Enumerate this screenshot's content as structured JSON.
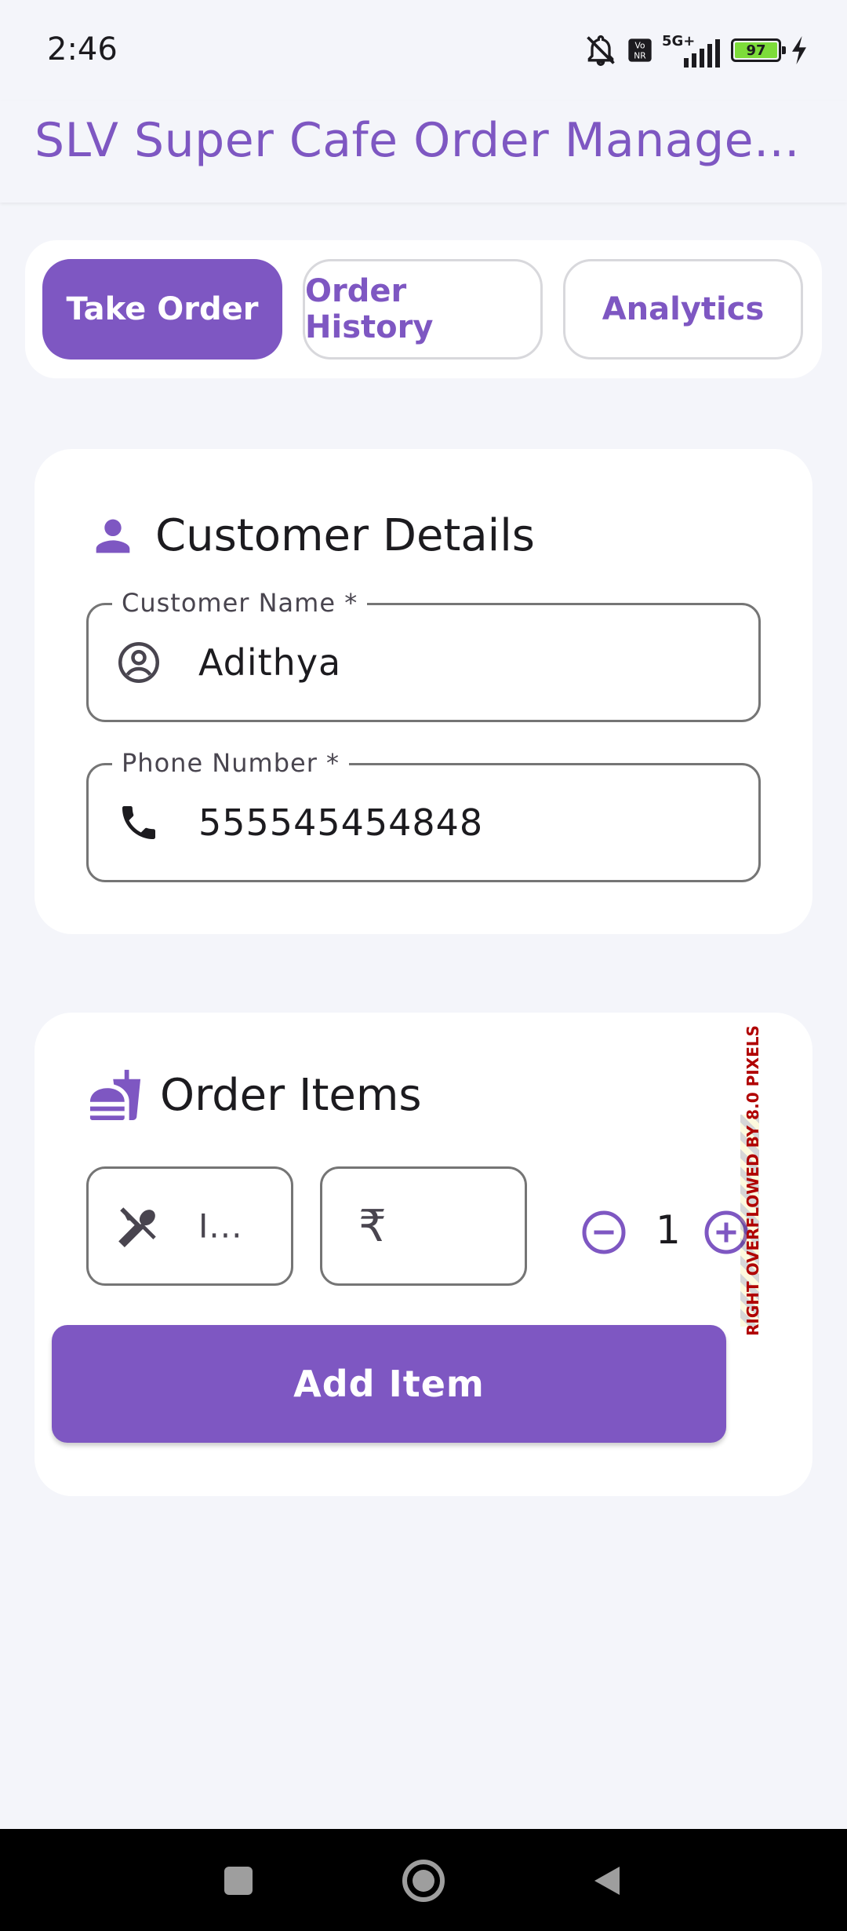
{
  "status_bar": {
    "time": "2:46",
    "battery": "97",
    "network": "5G+"
  },
  "app_bar": {
    "title": "SLV Super Cafe Order Manage..."
  },
  "tabs": [
    {
      "label": "Take Order",
      "active": true
    },
    {
      "label": "Order History",
      "active": false
    },
    {
      "label": "Analytics",
      "active": false
    }
  ],
  "customer_details": {
    "title": "Customer Details",
    "name_field": {
      "label": "Customer Name *",
      "value": "Adithya"
    },
    "phone_field": {
      "label": "Phone Number *",
      "value": "555545454848"
    }
  },
  "order_items": {
    "title": "Order Items",
    "item_field_value": "I...",
    "price_icon": "₹",
    "quantity": "1",
    "overflow_warning": "RIGHT OVERFLOWED BY 8.0 PIXELS",
    "add_button": "Add Item"
  },
  "colors": {
    "accent": "#7e57c2",
    "background": "#f4f5fa",
    "card": "#ffffff"
  }
}
